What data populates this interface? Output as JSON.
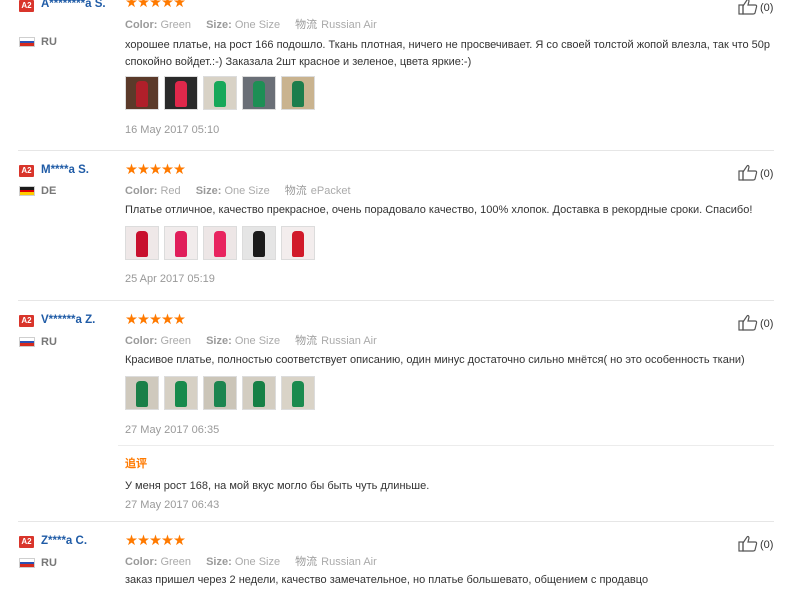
{
  "labels": {
    "color": "Color:",
    "size": "Size:",
    "shipping_glyph": "物流"
  },
  "colors": {
    "star": "#ff7a00",
    "user_link": "#1f5ba6",
    "badge": "#d9352b",
    "additional_label": "#ff7a00"
  },
  "reviews": [
    {
      "level": "A2",
      "name": "A********a S.",
      "country": "RU",
      "flag": "russia",
      "stars": "★★★★★",
      "rating": 5,
      "color": "Green",
      "size": "One Size",
      "shipping": "Russian Air",
      "text": "хорошее платье, на рост 166 подошло. Ткань плотная, ничего не просвечивает. Я со своей толстой жопой влезла, так что 50р спокойно войдет.:-) Заказала 2шт красное и зеленое, цвета яркие:-)",
      "photos": [
        "dark-red-dress-photo",
        "red-dress-photo",
        "green-dress-photo",
        "green-dress-mirror-photo",
        "green-dress-standing-photo"
      ],
      "date": "16 May 2017 05:10",
      "likes": "(0)"
    },
    {
      "level": "A2",
      "name": "M****a S.",
      "country": "DE",
      "flag": "germany",
      "stars": "★★★★★",
      "rating": 5,
      "color": "Red",
      "size": "One Size",
      "shipping": "ePacket",
      "text": "Платье отличное, качество прекрасное, очень порадовало качество, 100% хлопок. Доставка в рекордные сроки. Спасибо!",
      "photos": [
        "red-dress-label-photo",
        "red-dress-folded-photo",
        "red-dress-flat-photo",
        "phone-photo",
        "red-dress-hanging-photo"
      ],
      "date": "25 Apr 2017 05:19",
      "likes": "(0)"
    },
    {
      "level": "A2",
      "name": "V******a Z.",
      "country": "RU",
      "flag": "russia",
      "stars": "★★★★★",
      "rating": 5,
      "color": "Green",
      "size": "One Size",
      "shipping": "Russian Air",
      "text": "Красивое платье, полностью соответствует описанию, один минус достаточно сильно мнётся( но это особенность ткани)",
      "photos": [
        "green-dress-photo-1",
        "green-dress-photo-2",
        "green-dress-photo-3",
        "green-dress-photo-4",
        "green-dress-photo-5"
      ],
      "date": "27 May 2017 06:35",
      "likes": "(0)",
      "additional": {
        "label": "追评",
        "text": "У меня рост 168, на мой вкус могло бы быть чуть длиньше.",
        "date": "27 May 2017 06:43"
      }
    },
    {
      "level": "A2",
      "name": "Z****a C.",
      "country": "RU",
      "flag": "russia",
      "stars": "★★★★★",
      "rating": 5,
      "color": "Green",
      "size": "One Size",
      "shipping": "Russian Air",
      "text": "заказ пришел через 2 недели, качество замечательное, но платье большевато, общением с продавцо",
      "likes": "(0)"
    }
  ]
}
